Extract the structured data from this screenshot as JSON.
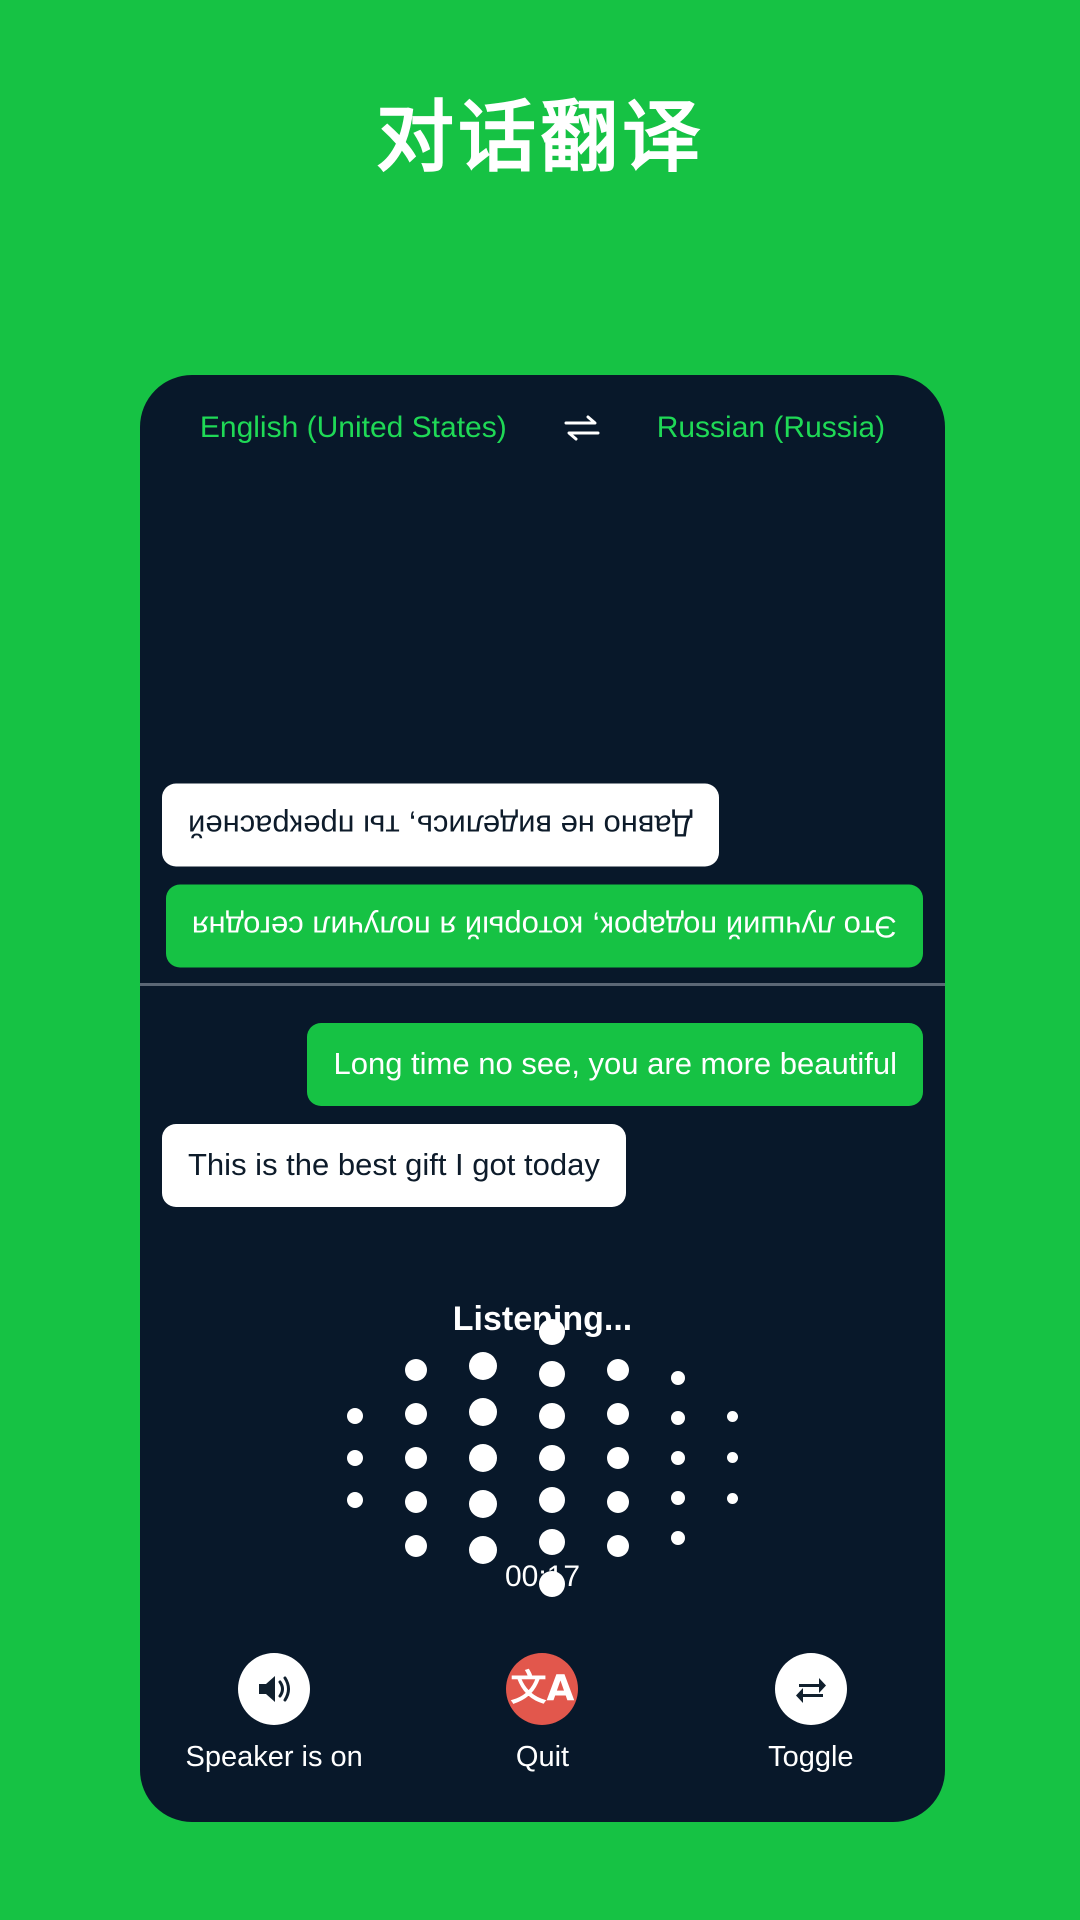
{
  "page": {
    "title": "对话翻译",
    "background_color": "#16c244"
  },
  "theme": {
    "brand_green": "#16c244",
    "accent_green": "#1fd956",
    "card_dark": "#08182a",
    "bubble_white": "#ffffff",
    "danger_red": "#e2574c",
    "divider_gray": "#5b6775"
  },
  "language_bar": {
    "source_language": "English (United States)",
    "swap_icon": "swap-horizontal-icon",
    "target_language": "Russian (Russia)"
  },
  "remote_pane": {
    "rotated": true,
    "messages": [
      {
        "text": "Это лучший подарок, который я получил сегодня",
        "style": "green",
        "align": "left"
      },
      {
        "text": "Давно не виделись, ты прекрасней",
        "style": "white",
        "align": "right"
      }
    ]
  },
  "local_pane": {
    "messages": [
      {
        "text": "Long time no see, you are more beautiful",
        "style": "green",
        "align": "right"
      },
      {
        "text": "This is the best gift I got today",
        "style": "white",
        "align": "left"
      }
    ]
  },
  "status": {
    "listening_label": "Listening...",
    "timer": "00:17"
  },
  "waveform": {
    "columns": [
      {
        "dots": 3,
        "size": 16,
        "gap": 26
      },
      {
        "dots": 5,
        "size": 22,
        "gap": 22
      },
      {
        "dots": 5,
        "size": 28,
        "gap": 18
      },
      {
        "dots": 7,
        "size": 26,
        "gap": 16
      },
      {
        "dots": 5,
        "size": 22,
        "gap": 22
      },
      {
        "dots": 5,
        "size": 14,
        "gap": 26
      },
      {
        "dots": 3,
        "size": 11,
        "gap": 30
      }
    ]
  },
  "controls": [
    {
      "label": "Speaker is on",
      "icon": "speaker-on-icon",
      "style": "light"
    },
    {
      "label": "Quit",
      "icon": "translate-icon",
      "style": "danger"
    },
    {
      "label": "Toggle",
      "icon": "swap-repeat-icon",
      "style": "light"
    }
  ]
}
